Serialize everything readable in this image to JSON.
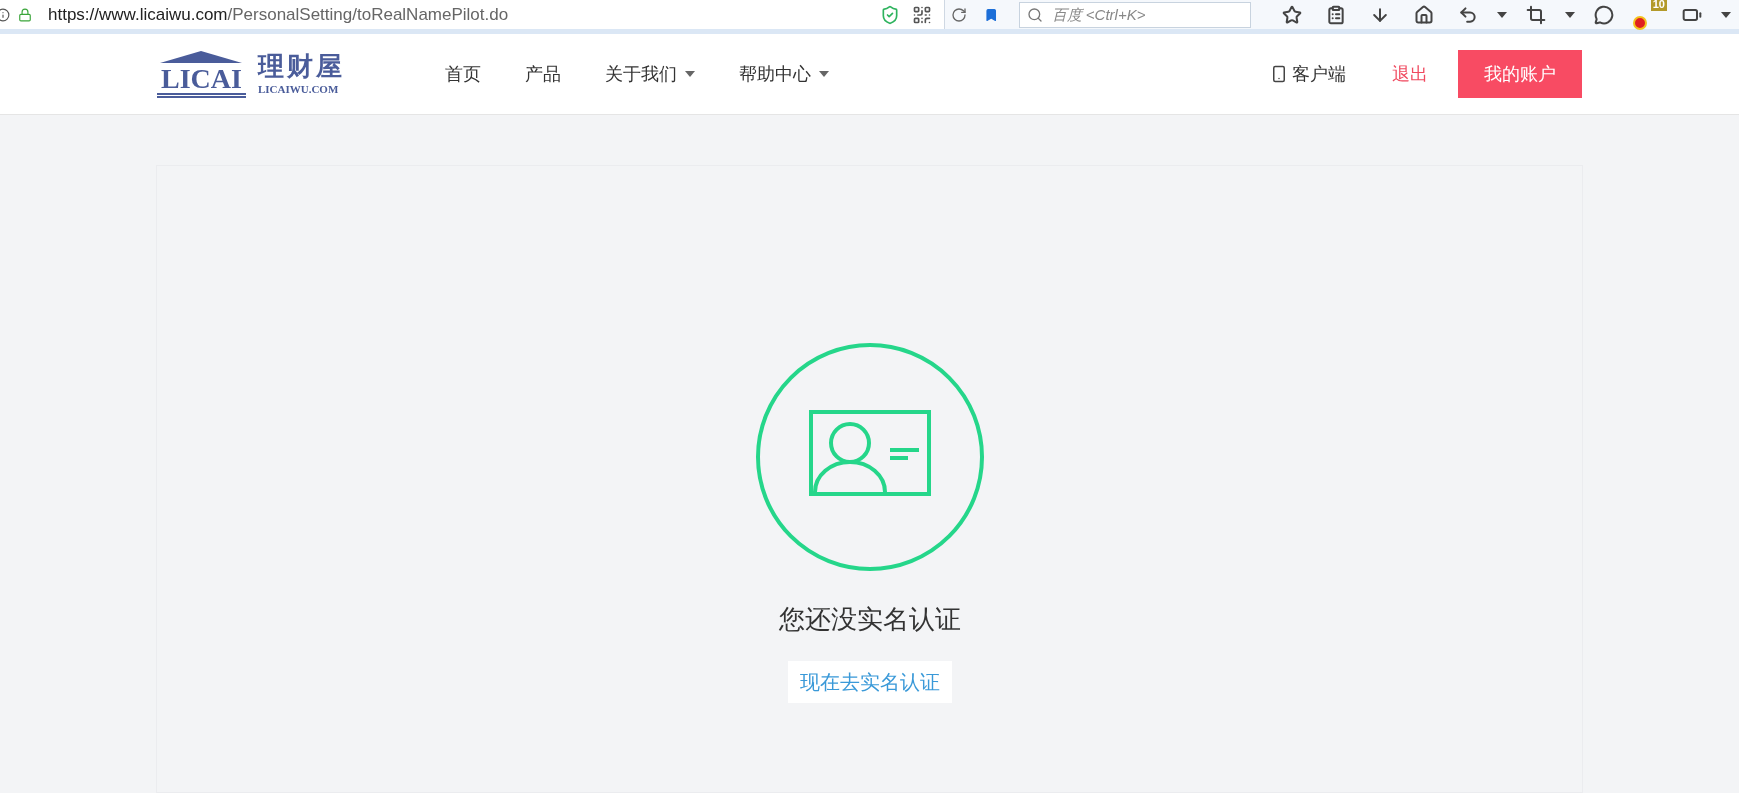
{
  "browser": {
    "url_domain": "https://www.licaiwu.com",
    "url_path": "/PersonalSetting/toRealNamePilot.do",
    "search_placeholder": "百度 <Ctrl+K>",
    "badge": "10"
  },
  "header": {
    "logo": {
      "mark": "LICAI",
      "name": "理财屋",
      "domain": "LICAIWU.COM"
    },
    "nav": [
      {
        "label": "首页",
        "dropdown": false
      },
      {
        "label": "产品",
        "dropdown": false
      },
      {
        "label": "关于我们",
        "dropdown": true
      },
      {
        "label": "帮助中心",
        "dropdown": true
      }
    ],
    "client": "客户端",
    "logout": "退出",
    "account": "我的账户"
  },
  "main": {
    "message": "您还没实名认证",
    "action": "现在去实名认证"
  }
}
